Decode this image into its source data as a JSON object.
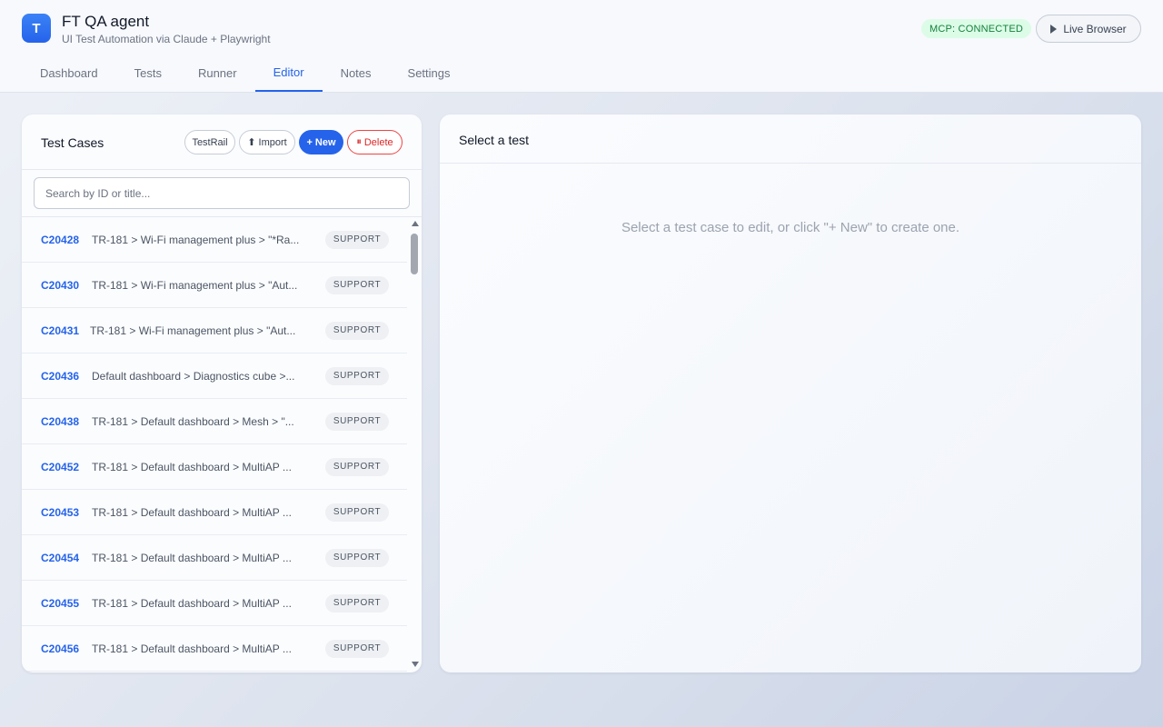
{
  "app": {
    "logo_letter": "T",
    "title": "FT QA agent",
    "subtitle": "UI Test Automation via Claude + Playwright",
    "mcp_status": "MCP: CONNECTED",
    "live_browser_label": "Live Browser"
  },
  "tabs": [
    {
      "label": "Dashboard",
      "active": false
    },
    {
      "label": "Tests",
      "active": false
    },
    {
      "label": "Runner",
      "active": false
    },
    {
      "label": "Editor",
      "active": true
    },
    {
      "label": "Notes",
      "active": false
    },
    {
      "label": "Settings",
      "active": false
    }
  ],
  "test_cases": {
    "title": "Test Cases",
    "buttons": {
      "testrail": "TestRail",
      "import": "Import",
      "new": "+ New",
      "delete": "Delete"
    },
    "search_placeholder": "Search by ID or title...",
    "items": [
      {
        "id": "C20428",
        "title": "TR-181 > Wi-Fi management plus > \"*Ra...",
        "tag": "SUPPORT"
      },
      {
        "id": "C20430",
        "title": "TR-181 > Wi-Fi management plus > \"Aut...",
        "tag": "SUPPORT"
      },
      {
        "id": "C20431",
        "title": "TR-181 > Wi-Fi management plus > \"Aut...",
        "tag": "SUPPORT"
      },
      {
        "id": "C20436",
        "title": "Default dashboard > Diagnostics cube >...",
        "tag": "SUPPORT"
      },
      {
        "id": "C20438",
        "title": "TR-181 > Default dashboard > Mesh > \"...",
        "tag": "SUPPORT"
      },
      {
        "id": "C20452",
        "title": "TR-181 > Default dashboard > MultiAP ...",
        "tag": "SUPPORT"
      },
      {
        "id": "C20453",
        "title": "TR-181 > Default dashboard > MultiAP ...",
        "tag": "SUPPORT"
      },
      {
        "id": "C20454",
        "title": "TR-181 > Default dashboard > MultiAP ...",
        "tag": "SUPPORT"
      },
      {
        "id": "C20455",
        "title": "TR-181 > Default dashboard > MultiAP ...",
        "tag": "SUPPORT"
      },
      {
        "id": "C20456",
        "title": "TR-181 > Default dashboard > MultiAP ...",
        "tag": "SUPPORT"
      }
    ]
  },
  "editor": {
    "title": "Select a test",
    "empty_message": "Select a test case to edit, or click \"+ New\" to create one."
  },
  "colors": {
    "accent": "#2563eb",
    "connected": "#15803d",
    "danger": "#dc2626"
  }
}
